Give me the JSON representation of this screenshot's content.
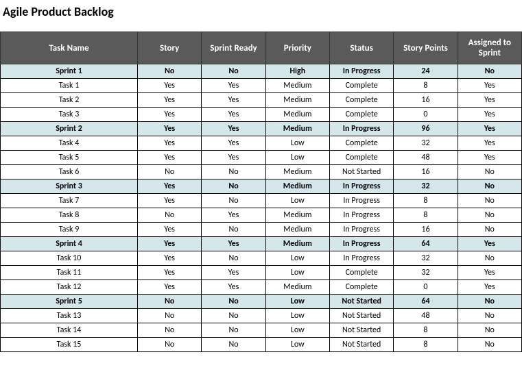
{
  "title": "Agile Product Backlog",
  "columns": [
    "Task Name",
    "Story",
    "Sprint Ready",
    "Priority",
    "Status",
    "Story Points",
    "Assigned to Sprint"
  ],
  "rows": [
    {
      "sprint": true,
      "name": "Sprint 1",
      "story": "No",
      "ready": "No",
      "priority": "High",
      "status": "In Progress",
      "points": "24",
      "assigned": "No"
    },
    {
      "sprint": false,
      "name": "Task 1",
      "story": "Yes",
      "ready": "Yes",
      "priority": "Medium",
      "status": "Complete",
      "points": "8",
      "assigned": "Yes"
    },
    {
      "sprint": false,
      "name": "Task 2",
      "story": "Yes",
      "ready": "Yes",
      "priority": "Medium",
      "status": "Complete",
      "points": "16",
      "assigned": "Yes"
    },
    {
      "sprint": false,
      "name": "Task 3",
      "story": "Yes",
      "ready": "Yes",
      "priority": "Medium",
      "status": "Complete",
      "points": "0",
      "assigned": "Yes"
    },
    {
      "sprint": true,
      "name": "Sprint 2",
      "story": "Yes",
      "ready": "Yes",
      "priority": "Medium",
      "status": "In Progress",
      "points": "96",
      "assigned": "Yes"
    },
    {
      "sprint": false,
      "name": "Task 4",
      "story": "Yes",
      "ready": "Yes",
      "priority": "Low",
      "status": "Complete",
      "points": "32",
      "assigned": "Yes"
    },
    {
      "sprint": false,
      "name": "Task 5",
      "story": "Yes",
      "ready": "Yes",
      "priority": "Low",
      "status": "Complete",
      "points": "48",
      "assigned": "Yes"
    },
    {
      "sprint": false,
      "name": "Task 6",
      "story": "No",
      "ready": "No",
      "priority": "Medium",
      "status": "Not Started",
      "points": "16",
      "assigned": "No"
    },
    {
      "sprint": true,
      "name": "Sprint 3",
      "story": "Yes",
      "ready": "No",
      "priority": "Medium",
      "status": "In Progress",
      "points": "32",
      "assigned": "No"
    },
    {
      "sprint": false,
      "name": "Task 7",
      "story": "Yes",
      "ready": "No",
      "priority": "Low",
      "status": "In Progress",
      "points": "8",
      "assigned": "No"
    },
    {
      "sprint": false,
      "name": "Task 8",
      "story": "No",
      "ready": "Yes",
      "priority": "Medium",
      "status": "In Progress",
      "points": "8",
      "assigned": "No"
    },
    {
      "sprint": false,
      "name": "Task 9",
      "story": "Yes",
      "ready": "No",
      "priority": "Medium",
      "status": "In Progress",
      "points": "16",
      "assigned": "No"
    },
    {
      "sprint": true,
      "name": "Sprint 4",
      "story": "Yes",
      "ready": "Yes",
      "priority": "Medium",
      "status": "In Progress",
      "points": "64",
      "assigned": "Yes"
    },
    {
      "sprint": false,
      "name": "Task 10",
      "story": "Yes",
      "ready": "No",
      "priority": "Low",
      "status": "In Progress",
      "points": "32",
      "assigned": "No"
    },
    {
      "sprint": false,
      "name": "Task 11",
      "story": "Yes",
      "ready": "Yes",
      "priority": "Low",
      "status": "Complete",
      "points": "32",
      "assigned": "Yes"
    },
    {
      "sprint": false,
      "name": "Task 12",
      "story": "Yes",
      "ready": "Yes",
      "priority": "Medium",
      "status": "Complete",
      "points": "0",
      "assigned": "Yes"
    },
    {
      "sprint": true,
      "name": "Sprint 5",
      "story": "No",
      "ready": "No",
      "priority": "Low",
      "status": "Not Started",
      "points": "64",
      "assigned": "No"
    },
    {
      "sprint": false,
      "name": "Task 13",
      "story": "No",
      "ready": "No",
      "priority": "Low",
      "status": "Not Started",
      "points": "48",
      "assigned": "No"
    },
    {
      "sprint": false,
      "name": "Task 14",
      "story": "No",
      "ready": "No",
      "priority": "Low",
      "status": "Not Started",
      "points": "8",
      "assigned": "No"
    },
    {
      "sprint": false,
      "name": "Task 15",
      "story": "No",
      "ready": "No",
      "priority": "Low",
      "status": "Not Started",
      "points": "8",
      "assigned": "No"
    }
  ]
}
